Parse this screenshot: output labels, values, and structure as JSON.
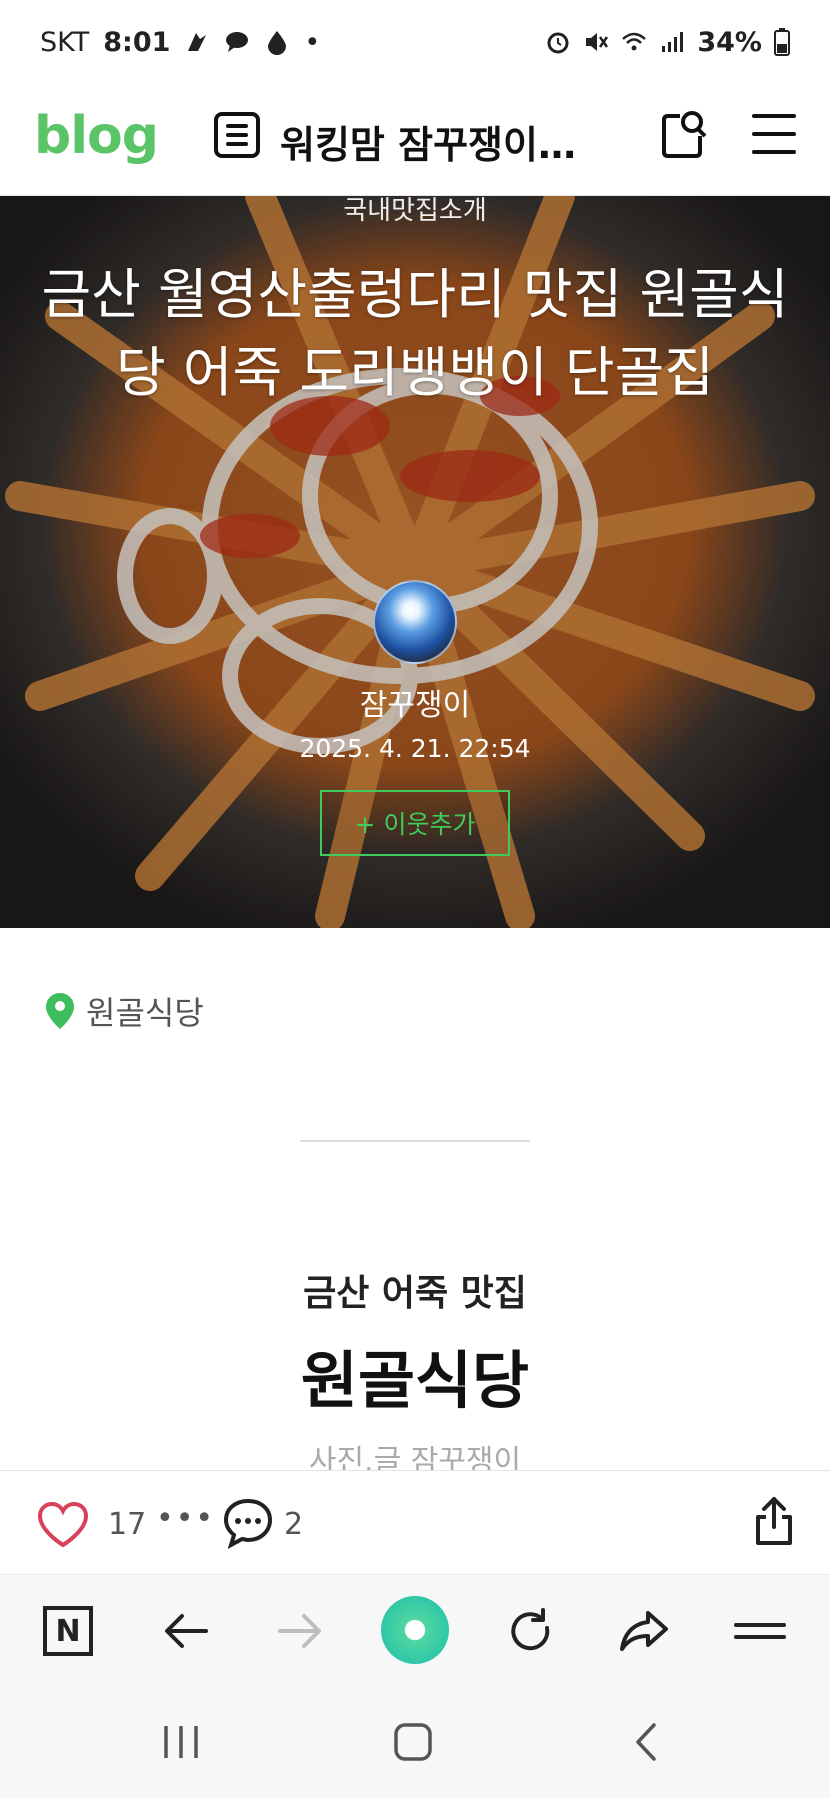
{
  "status_bar": {
    "carrier": "SKT",
    "time": "8:01",
    "dot": "•",
    "battery": "34%"
  },
  "header": {
    "logo": "blog",
    "blog_title": "워킹맘 잠꾸쟁이의 ...",
    "icons": [
      "list-icon",
      "search-icon",
      "menu-icon"
    ]
  },
  "hero": {
    "category": "국내맛집소개",
    "title": "금산 월영산출렁다리 맛집 원골식당 어죽 도리뱅뱅이 단골집",
    "author": "잠꾸쟁이",
    "date": "2025. 4. 21. 22:54",
    "neighbor_button": "+ 이웃추가"
  },
  "content": {
    "location": "원골식당",
    "subtitle": "금산 어죽 맛집",
    "heading": "원골식당",
    "credit": "사진.글 잠꾸쟁이"
  },
  "actions": {
    "like_count": "17",
    "more": "•••",
    "comment_count": "2"
  },
  "colors": {
    "brand_green": "#03c75a",
    "like_red": "#d9405a",
    "neighbor_green": "#3ecb59"
  }
}
